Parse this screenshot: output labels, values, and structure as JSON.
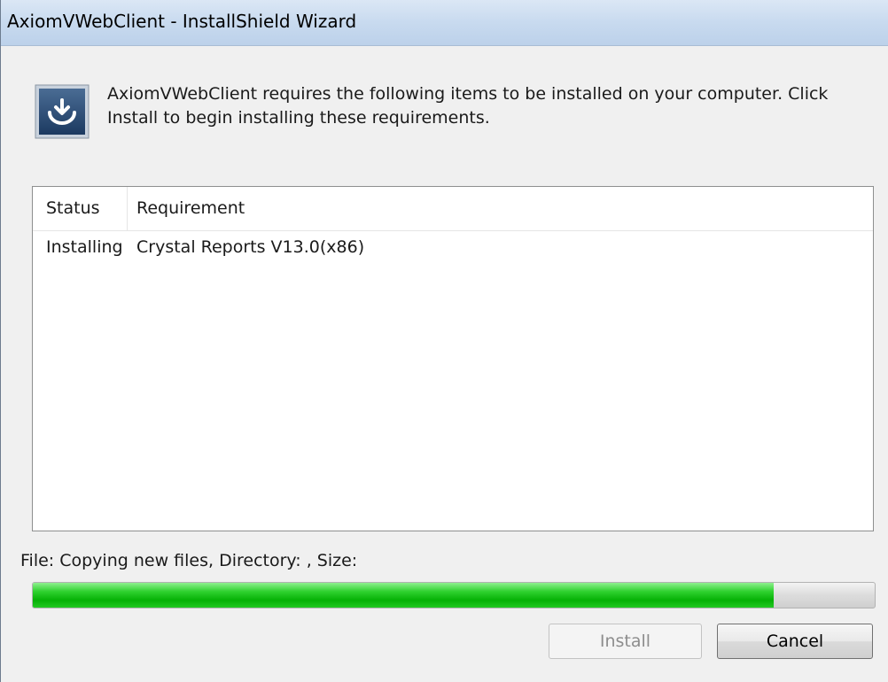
{
  "window": {
    "title": "AxiomVWebClient - InstallShield Wizard"
  },
  "header": {
    "icon": "installer-icon",
    "message": "AxiomVWebClient requires the following items to be installed on your computer. Click Install to begin installing these requirements."
  },
  "requirements_list": {
    "columns": [
      "Status",
      "Requirement"
    ],
    "rows": [
      {
        "status": "Installing",
        "requirement": "Crystal Reports V13.0(x86)"
      }
    ]
  },
  "file_status": "File: Copying new files,  Directory: ,  Size:",
  "progress": {
    "percent": 88,
    "fill_color": "#06b106"
  },
  "buttons": {
    "install_label": "Install",
    "install_enabled": false,
    "cancel_label": "Cancel"
  }
}
